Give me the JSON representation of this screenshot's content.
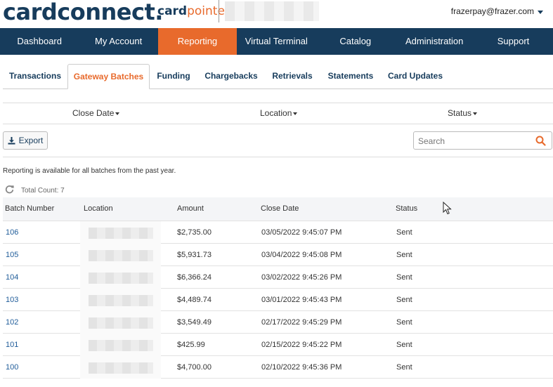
{
  "header": {
    "logo_main": "cardconnect",
    "logo_dot": ".",
    "logo_sub_card": "card",
    "logo_sub_pointe": "pointe",
    "user_email": "frazerpay@frazer.com"
  },
  "nav": {
    "items": [
      "Dashboard",
      "My Account",
      "Reporting",
      "Virtual Terminal",
      "Catalog",
      "Administration",
      "Support"
    ],
    "active": "Reporting"
  },
  "subtabs": {
    "items": [
      "Transactions",
      "Gateway Batches",
      "Funding",
      "Chargebacks",
      "Retrievals",
      "Statements",
      "Card Updates"
    ],
    "active": "Gateway Batches"
  },
  "filters": {
    "close_date": "Close Date",
    "location": "Location",
    "status": "Status"
  },
  "toolbar": {
    "export_label": "Export",
    "search_placeholder": "Search"
  },
  "info": {
    "note": "Reporting is available for all batches from the past year.",
    "total_count": "Total Count: 7"
  },
  "table": {
    "headers": [
      "Batch Number",
      "Location",
      "Amount",
      "Close Date",
      "Status"
    ],
    "rows": [
      {
        "batch": "106",
        "amount": "$2,735.00",
        "close_date": "03/05/2022 9:45:07 PM",
        "status": "Sent"
      },
      {
        "batch": "105",
        "amount": "$5,931.73",
        "close_date": "03/04/2022 9:45:08 PM",
        "status": "Sent"
      },
      {
        "batch": "104",
        "amount": "$6,366.24",
        "close_date": "03/02/2022 9:45:26 PM",
        "status": "Sent"
      },
      {
        "batch": "103",
        "amount": "$4,489.74",
        "close_date": "03/01/2022 9:45:43 PM",
        "status": "Sent"
      },
      {
        "batch": "102",
        "amount": "$3,549.49",
        "close_date": "02/17/2022 9:45:29 PM",
        "status": "Sent"
      },
      {
        "batch": "101",
        "amount": "$425.99",
        "close_date": "02/15/2022 9:45:22 PM",
        "status": "Sent"
      },
      {
        "batch": "100",
        "amount": "$4,700.00",
        "close_date": "02/10/2022 9:45:36 PM",
        "status": "Sent"
      }
    ]
  },
  "colors": {
    "navy": "#173c5c",
    "orange": "#e86a2c",
    "link": "#1f5c99"
  }
}
